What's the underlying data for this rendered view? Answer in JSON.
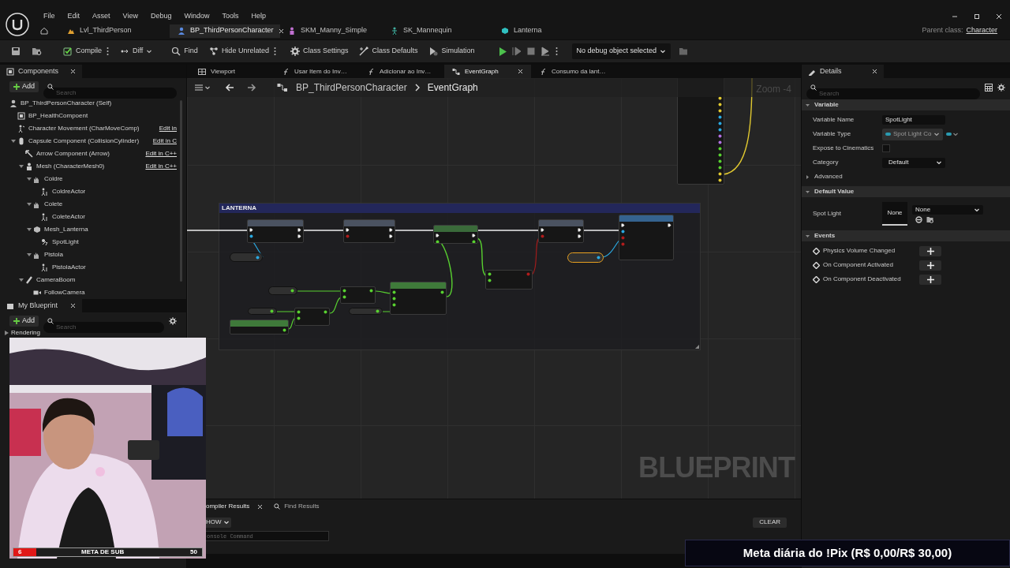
{
  "menu": [
    "File",
    "Edit",
    "Asset",
    "View",
    "Debug",
    "Window",
    "Tools",
    "Help"
  ],
  "document_tabs": [
    {
      "label": "Lvl_ThirdPerson",
      "kind": "level",
      "selected": false
    },
    {
      "label": "BP_ThirdPersonCharacter",
      "kind": "blueprint",
      "selected": true
    },
    {
      "label": "SKM_Manny_Simple",
      "kind": "skeletal-mesh",
      "selected": false
    },
    {
      "label": "SK_Mannequin",
      "kind": "skeleton",
      "selected": false
    },
    {
      "label": "Lanterna",
      "kind": "static-mesh",
      "selected": false
    }
  ],
  "parent_class": {
    "label": "Parent class:",
    "value": "Character"
  },
  "toolbar": [
    {
      "label": "Compile",
      "kind": "compile"
    },
    {
      "label": "Diff",
      "kind": "diff"
    },
    {
      "label": "Find",
      "kind": "find"
    },
    {
      "label": "Hide Unrelated",
      "kind": "hide"
    },
    {
      "label": "Class Settings",
      "kind": "settings"
    },
    {
      "label": "Class Defaults",
      "kind": "defaults"
    },
    {
      "label": "Simulation",
      "kind": "simulation"
    }
  ],
  "debug_object": "No debug object selected",
  "components": {
    "title": "Components",
    "add": "Add",
    "search_placeholder": "Search",
    "tree": [
      {
        "label": "BP_ThirdPersonCharacter (Self)",
        "kind": "actor",
        "children": [
          {
            "label": "BP_HealthCompoent",
            "kind": "component"
          },
          {
            "label": "Character Movement (CharMoveComp)",
            "kind": "movement",
            "link": "Edit in"
          },
          {
            "label": "Capsule Component (CollisionCylinder)",
            "kind": "capsule",
            "link": "Edit in C",
            "children": [
              {
                "label": "Arrow Component (Arrow)",
                "kind": "arrow",
                "link": "Edit in C++"
              },
              {
                "label": "Mesh (CharacterMesh0)",
                "kind": "mesh",
                "link": "Edit in C++",
                "children": [
                  {
                    "label": "Coldre",
                    "kind": "child-actor",
                    "children": [
                      {
                        "label": "ColdreActor",
                        "kind": "actor-ref"
                      }
                    ]
                  },
                  {
                    "label": "Colete",
                    "kind": "child-actor",
                    "children": [
                      {
                        "label": "ColeteActor",
                        "kind": "actor-ref"
                      }
                    ]
                  },
                  {
                    "label": "Mesh_Lanterna",
                    "kind": "static-mesh",
                    "children": [
                      {
                        "label": "SpotLight",
                        "kind": "light"
                      }
                    ]
                  },
                  {
                    "label": "Pistola",
                    "kind": "child-actor",
                    "children": [
                      {
                        "label": "PistolaActor",
                        "kind": "actor-ref"
                      }
                    ]
                  }
                ]
              },
              {
                "label": "CameraBoom",
                "kind": "spring-arm",
                "children": [
                  {
                    "label": "FollowCamera",
                    "kind": "camera"
                  }
                ]
              }
            ]
          }
        ]
      }
    ]
  },
  "my_blueprint": {
    "title": "My Blueprint",
    "add": "Add",
    "search_placeholder": "Search",
    "category": "Rendering"
  },
  "graph_tabs": [
    {
      "label": "Viewport",
      "kind": "viewport",
      "selected": false
    },
    {
      "label": "Usar Item do Inv…",
      "kind": "function",
      "selected": false
    },
    {
      "label": "Adicionar ao Inv…",
      "kind": "function",
      "selected": false
    },
    {
      "label": "EventGraph",
      "kind": "graph",
      "selected": true
    },
    {
      "label": "Consumo da lant…",
      "kind": "function",
      "selected": false
    }
  ],
  "breadcrumb": [
    "BP_ThirdPersonCharacter",
    "EventGraph"
  ],
  "graph": {
    "comment": "LANTERNA",
    "zoom_label": "Zoom -4",
    "watermark": "BLUEPRINT",
    "nodes": [
      {
        "kind": "function",
        "color": "#4a5260"
      },
      {
        "kind": "getter",
        "selected": false
      },
      {
        "kind": "function",
        "color": "#4a5260"
      },
      {
        "kind": "set",
        "color": "#3a6a3a"
      },
      {
        "kind": "compare"
      },
      {
        "kind": "function",
        "color": "#4a5260"
      },
      {
        "kind": "function",
        "color": "#35638f"
      },
      {
        "kind": "getter",
        "selected": true
      },
      {
        "kind": "getter",
        "selected": false
      },
      {
        "kind": "operator"
      },
      {
        "kind": "function",
        "color": "#3f7a3a"
      },
      {
        "kind": "getter",
        "selected": false
      },
      {
        "kind": "operator"
      },
      {
        "kind": "getter",
        "selected": false
      },
      {
        "kind": "function",
        "color": "#3f7a3a"
      },
      {
        "kind": "pins"
      }
    ]
  },
  "bottom_panel": {
    "tabs": [
      {
        "label": "ompiler Results",
        "kind": "closable",
        "selected": true
      },
      {
        "label": "Find Results",
        "kind": "search",
        "selected": false
      }
    ],
    "filter": "HOW",
    "console_placeholder": "onsole Command",
    "clear": "CLEAR"
  },
  "details": {
    "title": "Details",
    "search_placeholder": "Search",
    "sections": [
      {
        "title": "Variable",
        "expanded": true,
        "rows": [
          {
            "kind": "text",
            "label": "Variable Name",
            "value": "SpotLight"
          },
          {
            "kind": "type",
            "label": "Variable Type",
            "value": "Spot Light Co"
          },
          {
            "kind": "checkbox",
            "label": "Expose to Cinematics",
            "checked": false
          },
          {
            "kind": "dropdown",
            "label": "Category",
            "value": "Default"
          },
          {
            "kind": "group",
            "label": "Advanced",
            "expanded": false
          }
        ]
      },
      {
        "title": "Default Value",
        "expanded": true,
        "rows": [
          {
            "kind": "asset",
            "label": "Spot Light",
            "thumbnail": "None",
            "value": "None"
          }
        ]
      },
      {
        "title": "Events",
        "expanded": true,
        "rows": [
          {
            "kind": "event",
            "label": "Physics Volume Changed"
          },
          {
            "kind": "event",
            "label": "On Component Activated"
          },
          {
            "kind": "event",
            "label": "On Component Deactivated"
          }
        ]
      }
    ]
  },
  "webcam": {
    "goal": {
      "current": "6",
      "label": "META DE SUB",
      "target": "50",
      "level": 0.12
    }
  },
  "pix_goal": "Meta diária do !Pix (R$ 0,00/R$ 30,00)"
}
